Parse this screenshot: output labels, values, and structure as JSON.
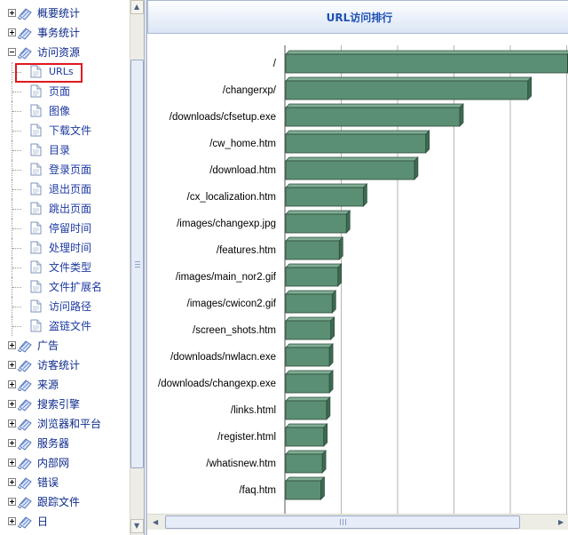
{
  "tree": {
    "top_items": [
      {
        "label": "概要统计",
        "expanded": false
      },
      {
        "label": "事务统计",
        "expanded": false
      },
      {
        "label": "访问资源",
        "expanded": true
      },
      {
        "label": "广告",
        "expanded": false
      },
      {
        "label": "访客统计",
        "expanded": false
      },
      {
        "label": "来源",
        "expanded": false
      },
      {
        "label": "搜索引擎",
        "expanded": false
      },
      {
        "label": "浏览器和平台",
        "expanded": false
      },
      {
        "label": "服务器",
        "expanded": false
      },
      {
        "label": "内部网",
        "expanded": false
      },
      {
        "label": "错误",
        "expanded": false
      },
      {
        "label": "跟踪文件",
        "expanded": false
      },
      {
        "label": "日",
        "expanded": false
      }
    ],
    "access_children": [
      {
        "label": "URLs",
        "selected": true
      },
      {
        "label": "页面"
      },
      {
        "label": "图像"
      },
      {
        "label": "下载文件"
      },
      {
        "label": "目录"
      },
      {
        "label": "登录页面"
      },
      {
        "label": "退出页面"
      },
      {
        "label": "跳出页面"
      },
      {
        "label": "停留时间"
      },
      {
        "label": "处理时间"
      },
      {
        "label": "文件类型"
      },
      {
        "label": "文件扩展名"
      },
      {
        "label": "访问路径"
      },
      {
        "label": "盗链文件"
      }
    ]
  },
  "panel": {
    "title": "URL访问排行"
  },
  "colors": {
    "bar_front": "#5a8f73",
    "bar_side": "#3d6a52",
    "bar_top": "#7fae95",
    "grid": "#b5b5b5",
    "tree_text": "#0c2a8a",
    "title_text": "#1d52b3",
    "selection": "#e0191e"
  },
  "icons": {
    "tree_node": "scroll-note-icon",
    "tree_page": "page-icon",
    "scroll_up": "arrow-up-icon",
    "scroll_down": "arrow-down-icon",
    "scroll_left": "arrow-left-icon",
    "scroll_right": "arrow-right-icon"
  },
  "chart_data": {
    "type": "bar",
    "orientation": "horizontal",
    "categories": [
      "/",
      "/changerxp/",
      "/downloads/cfsetup.exe",
      "/cw_home.htm",
      "/download.htm",
      "/cx_localization.htm",
      "/images/changexp.jpg",
      "/features.htm",
      "/images/main_nor2.gif",
      "/images/cwicon2.gif",
      "/screen_shots.htm",
      "/downloads/nwlacn.exe",
      "/downloads/changexp.exe",
      "/links.html",
      "/register.html",
      "/whatisnew.htm",
      "/faq.htm"
    ],
    "values": [
      100,
      86,
      62,
      50,
      46,
      28,
      22,
      19.5,
      19,
      17,
      16.5,
      16,
      16,
      15,
      14,
      13.5,
      13
    ],
    "grid": true
  }
}
